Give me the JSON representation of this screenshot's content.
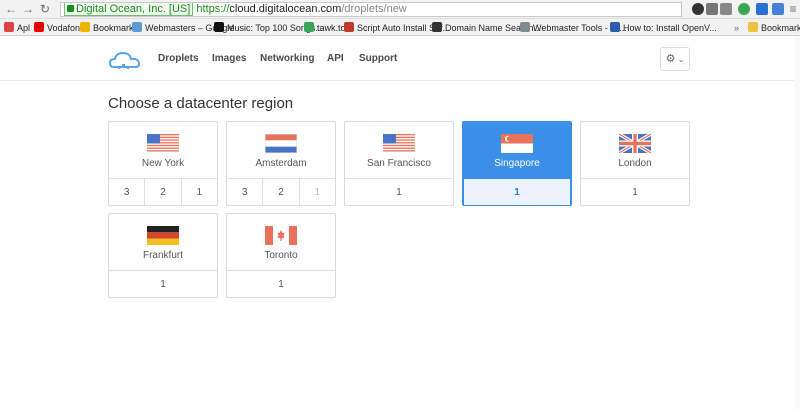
{
  "browser": {
    "ev_label": "Digital Ocean, Inc. [US]",
    "url_scheme": "https://",
    "url_host": "cloud.digitalocean.com",
    "url_path": "/droplets/new"
  },
  "bookmarks": [
    {
      "label": "Apl",
      "color": "#d44"
    },
    {
      "label": "Vodafone",
      "color": "#e60000"
    },
    {
      "label": "Bookmarks",
      "color": "#f0b400"
    },
    {
      "label": "Webmasters – Google",
      "color": "#5b9bd5"
    },
    {
      "label": "Music: Top 100 Songs...",
      "color": "#111"
    },
    {
      "label": "tawk.to",
      "color": "#3aa657"
    },
    {
      "label": "Script Auto Install Sof...",
      "color": "#c0392b"
    },
    {
      "label": "Domain Name Search...",
      "color": "#333"
    },
    {
      "label": "Webmaster Tools - Cr...",
      "color": "#7f8c8d"
    },
    {
      "label": "How to: Install OpenV...",
      "color": "#2a5db0"
    }
  ],
  "bookmark_other": "Bookmark lai",
  "nav": {
    "links": [
      "Droplets",
      "Images",
      "Networking",
      "API",
      "Support"
    ]
  },
  "page": {
    "title": "Choose a datacenter region"
  },
  "regions": [
    {
      "city": "New York",
      "flag": "us",
      "options": [
        "3",
        "2",
        "1"
      ],
      "disabled": []
    },
    {
      "city": "Amsterdam",
      "flag": "nl",
      "options": [
        "3",
        "2",
        "1"
      ],
      "disabled": [
        2
      ]
    },
    {
      "city": "San Francisco",
      "flag": "us",
      "options": [
        "1"
      ],
      "disabled": []
    },
    {
      "city": "Singapore",
      "flag": "sg",
      "options": [
        "1"
      ],
      "disabled": [],
      "selected": true
    },
    {
      "city": "London",
      "flag": "uk",
      "options": [
        "1"
      ],
      "disabled": []
    },
    {
      "city": "Frankfurt",
      "flag": "de",
      "options": [
        "1"
      ],
      "disabled": []
    },
    {
      "city": "Toronto",
      "flag": "ca",
      "options": [
        "1"
      ],
      "disabled": []
    }
  ],
  "colors": {
    "accent": "#3b8fe6",
    "flag_red": "#e8735a",
    "flag_blue": "#4a74c6"
  }
}
